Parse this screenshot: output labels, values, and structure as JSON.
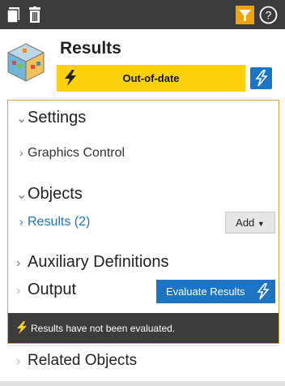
{
  "toolbar": {
    "icons": [
      "copy-icon",
      "trash-icon",
      "filter-icon",
      "help-icon"
    ],
    "filter_color": "#f0a30a"
  },
  "header": {
    "title": "Results",
    "status": "Out-of-date",
    "status_color": "#fbd20b",
    "icon": "cube-icon"
  },
  "sections": {
    "settings": {
      "label": "Settings",
      "child": "Graphics Control"
    },
    "objects": {
      "label": "Objects",
      "child": "Results (2)",
      "add_label": "Add"
    },
    "auxiliary": {
      "label": "Auxiliary Definitions"
    },
    "output": {
      "label": "Output",
      "evaluate_label": "Evaluate Results"
    }
  },
  "footer": {
    "message": "Results have not been evaluated."
  },
  "related": {
    "label": "Related Objects"
  },
  "colors": {
    "accent": "#1b74c4",
    "dark_bar": "#3c3c3c"
  }
}
